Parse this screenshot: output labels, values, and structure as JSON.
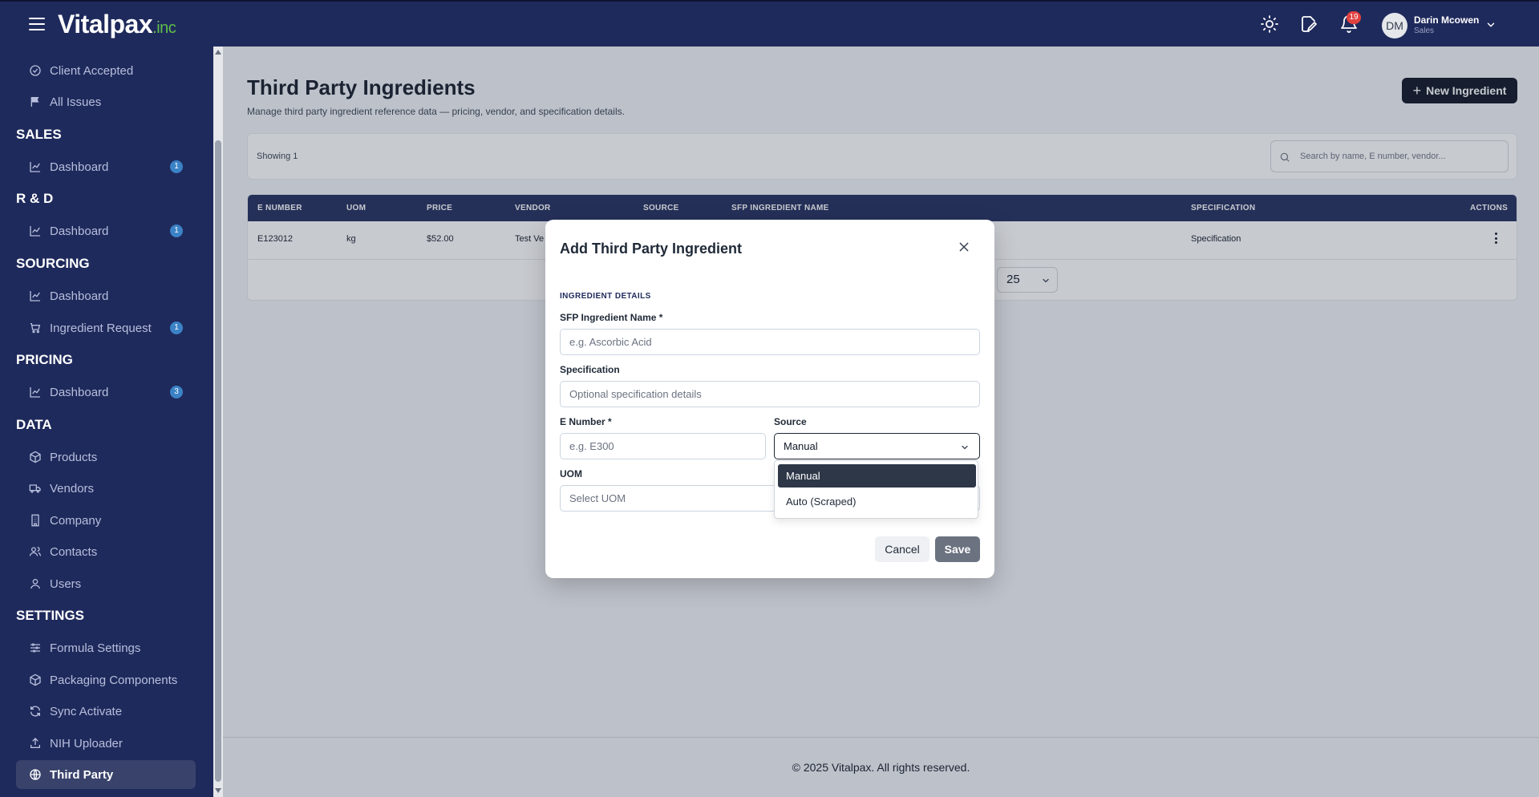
{
  "app": {
    "logo_main": "Vitalpax",
    "logo_suffix": ".inc",
    "notifications_count": "19",
    "user_initials": "DM",
    "user_name": "Darin Mcowen",
    "user_role": "Sales"
  },
  "sidebar": {
    "client_accepted": "Client Accepted",
    "all_issues": "All Issues",
    "sales_header": "SALES",
    "sales_dashboard": "Dashboard",
    "sales_dashboard_count": "1",
    "rd_header": "R & D",
    "rd_dashboard": "Dashboard",
    "rd_dashboard_count": "1",
    "sourcing_header": "SOURCING",
    "sourcing_dashboard": "Dashboard",
    "ingredient_request": "Ingredient Request",
    "ingredient_request_count": "1",
    "pricing_header": "PRICING",
    "pricing_dashboard": "Dashboard",
    "pricing_dashboard_count": "3",
    "data_header": "DATA",
    "products": "Products",
    "vendors": "Vendors",
    "company": "Company",
    "contacts": "Contacts",
    "users": "Users",
    "settings_header": "SETTINGS",
    "formula_settings": "Formula Settings",
    "packaging_components": "Packaging Components",
    "sync_activate": "Sync Activate",
    "nih_uploader": "NIH Uploader",
    "third_party": "Third Party"
  },
  "main": {
    "title": "Third Party Ingredients",
    "subtitle": "Manage third party ingredient reference data — pricing, vendor, and specification details.",
    "new_button": "New Ingredient",
    "showing": "Showing 1",
    "search_placeholder": "Search by name, E number, vendor...",
    "columns": {
      "e_number": "E NUMBER",
      "uom": "UOM",
      "price": "PRICE",
      "vendor": "VENDOR",
      "source": "SOURCE",
      "sfp_name": "SFP INGREDIENT NAME",
      "specification": "SPECIFICATION",
      "actions": "ACTIONS"
    },
    "row": {
      "e_number": "E123012",
      "uom": "kg",
      "price": "$52.00",
      "vendor": "Test Ve",
      "specification": "Specification"
    },
    "per_page": "25",
    "footer": "© 2025 Vitalpax. All rights reserved."
  },
  "modal": {
    "title": "Add Third Party Ingredient",
    "section": "INGREDIENT DETAILS",
    "sfp_label": "SFP Ingredient Name *",
    "sfp_placeholder": "e.g. Ascorbic Acid",
    "spec_label": "Specification",
    "spec_placeholder": "Optional specification details",
    "e_number_label": "E Number *",
    "e_number_placeholder": "e.g. E300",
    "source_label": "Source",
    "source_value": "Manual",
    "uom_label": "UOM",
    "uom_placeholder": "Select UOM",
    "source_options": [
      "Manual",
      "Auto (Scraped)"
    ],
    "cancel": "Cancel",
    "save": "Save"
  },
  "colors": {
    "navy": "#1f2a5c",
    "brand_green": "#5fbf4a",
    "badge_blue": "#3b82c6",
    "badge_red": "#e0413f"
  }
}
